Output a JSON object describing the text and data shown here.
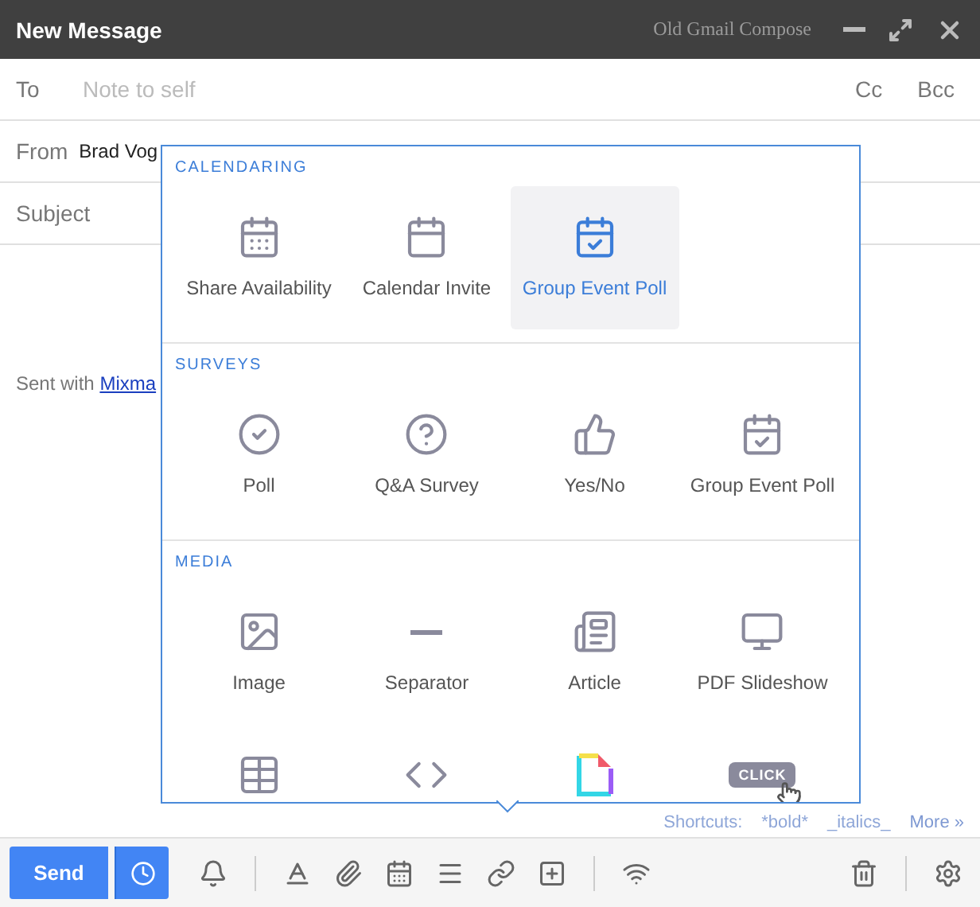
{
  "header": {
    "title": "New Message",
    "brand": "Old Gmail Compose"
  },
  "to": {
    "label": "To",
    "placeholder": "Note to self",
    "cc": "Cc",
    "bcc": "Bcc"
  },
  "from": {
    "label": "From",
    "value": "Brad Vog"
  },
  "subject": {
    "label": "Subject"
  },
  "body": {
    "signature": "Sent with ",
    "link": "Mixma"
  },
  "menu": {
    "sections": [
      {
        "title": "CALENDARING",
        "items": [
          {
            "kind": "availability",
            "label": "Share Availability",
            "selected": false
          },
          {
            "kind": "invite",
            "label": "Calendar Invite",
            "selected": false
          },
          {
            "kind": "eventpoll",
            "label": "Group Event Poll",
            "selected": true
          }
        ]
      },
      {
        "title": "SURVEYS",
        "items": [
          {
            "kind": "poll",
            "label": "Poll",
            "selected": false
          },
          {
            "kind": "qa",
            "label": "Q&A Survey",
            "selected": false
          },
          {
            "kind": "yesno",
            "label": "Yes/No",
            "selected": false
          },
          {
            "kind": "eventpoll",
            "label": "Group Event Poll",
            "selected": false
          }
        ]
      },
      {
        "title": "MEDIA",
        "items": [
          {
            "kind": "image",
            "label": "Image",
            "selected": false
          },
          {
            "kind": "separator",
            "label": "Separator",
            "selected": false
          },
          {
            "kind": "article",
            "label": "Article",
            "selected": false
          },
          {
            "kind": "slideshow",
            "label": "PDF Slideshow",
            "selected": false
          },
          {
            "kind": "table",
            "selected": false
          },
          {
            "kind": "code",
            "selected": false
          },
          {
            "kind": "gif",
            "selected": false
          },
          {
            "kind": "click",
            "badge": "CLICK",
            "selected": false
          }
        ]
      }
    ]
  },
  "shortcuts": {
    "label": "Shortcuts:",
    "items": [
      "*bold*",
      "_italics_"
    ],
    "more": "More »"
  },
  "toolbar": {
    "send": "Send"
  }
}
